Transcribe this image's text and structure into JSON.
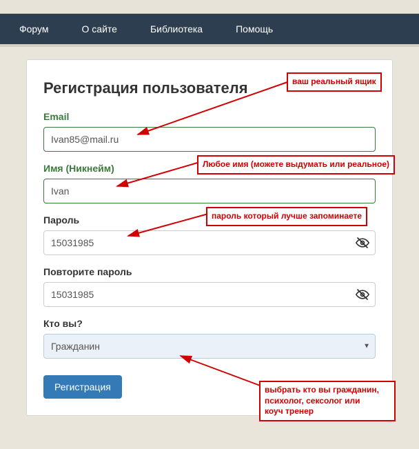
{
  "nav": {
    "items": [
      "Форум",
      "О сайте",
      "Библиотека",
      "Помощь"
    ]
  },
  "form": {
    "title": "Регистрация пользователя",
    "email_label": "Email",
    "email_value": "Ivan85@mail.ru",
    "name_label": "Имя (Никнейм)",
    "name_value": "Ivan",
    "password_label": "Пароль",
    "password_value": "15031985",
    "password2_label": "Повторите пароль",
    "password2_value": "15031985",
    "role_label": "Кто вы?",
    "role_selected": "Гражданин",
    "submit": "Регистрация"
  },
  "annotations": {
    "email": "ваш реальный ящик",
    "name": "Любое имя (можете выдумать или реальное)",
    "password": "пароль который лучше запоминаете",
    "role": "выбрать кто вы гражданин,\nпсихолог, сексолог или\nкоуч тренер"
  }
}
